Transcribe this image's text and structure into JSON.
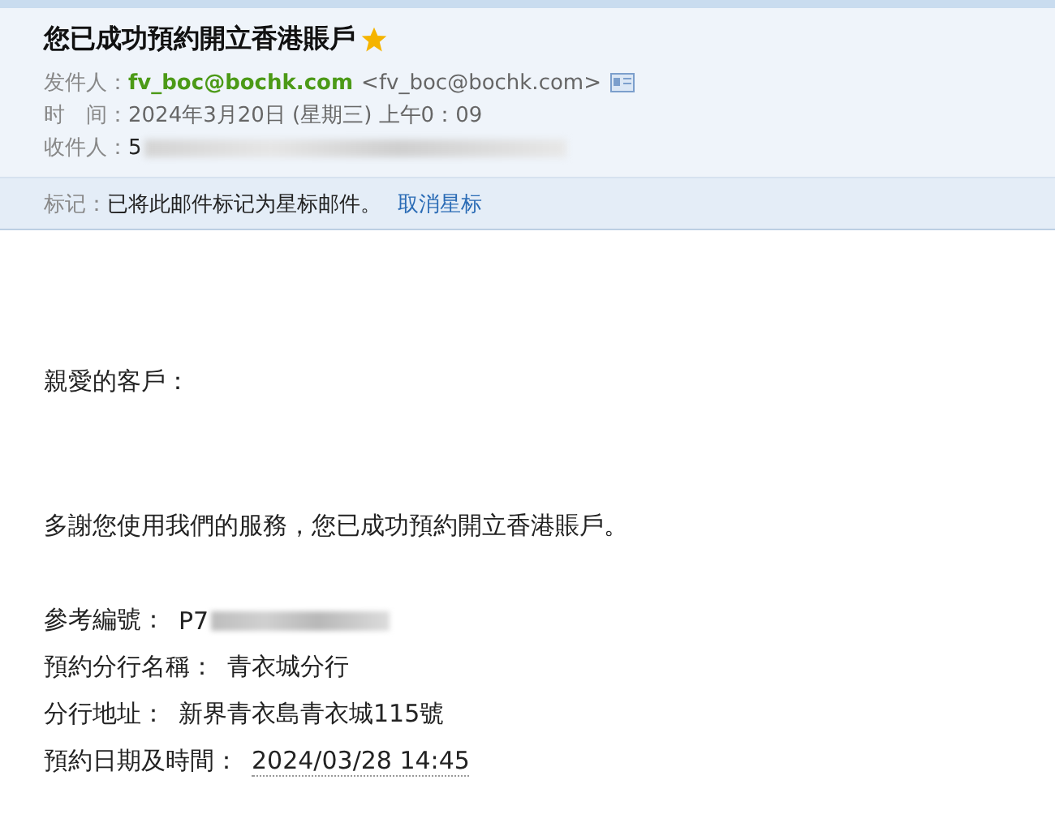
{
  "subject": {
    "title": "您已成功預約開立香港賬戶",
    "starred": true
  },
  "fields": [
    {
      "label": "发件人：",
      "kind": "sender",
      "name": "fv_boc@bochk.com",
      "address": "<fv_boc@bochk.com>"
    },
    {
      "label": "时　间：",
      "kind": "text",
      "value": "2024年3月20日 (星期三) 上午0：09"
    },
    {
      "label": "收件人：",
      "kind": "redacted",
      "value": "5"
    }
  ],
  "tag_bar": {
    "label": "标记：",
    "message": "已将此邮件标记为星标邮件。",
    "link": "取消星标"
  },
  "body": {
    "greeting": "親愛的客戶：",
    "message": "多謝您使用我們的服務，您已成功預約開立香港賬戶。",
    "details": [
      {
        "label": "參考編號：",
        "value": "P7",
        "redacted": true,
        "underlined": false
      },
      {
        "label": "預約分行名稱：",
        "value": "青衣城分行",
        "redacted": false,
        "underlined": false
      },
      {
        "label": "分行地址：",
        "value": "新界青衣島青衣城115號",
        "redacted": false,
        "underlined": false
      },
      {
        "label": "預約日期及時間：",
        "value": "2024/03/28 14:45",
        "redacted": false,
        "underlined": true
      }
    ]
  }
}
